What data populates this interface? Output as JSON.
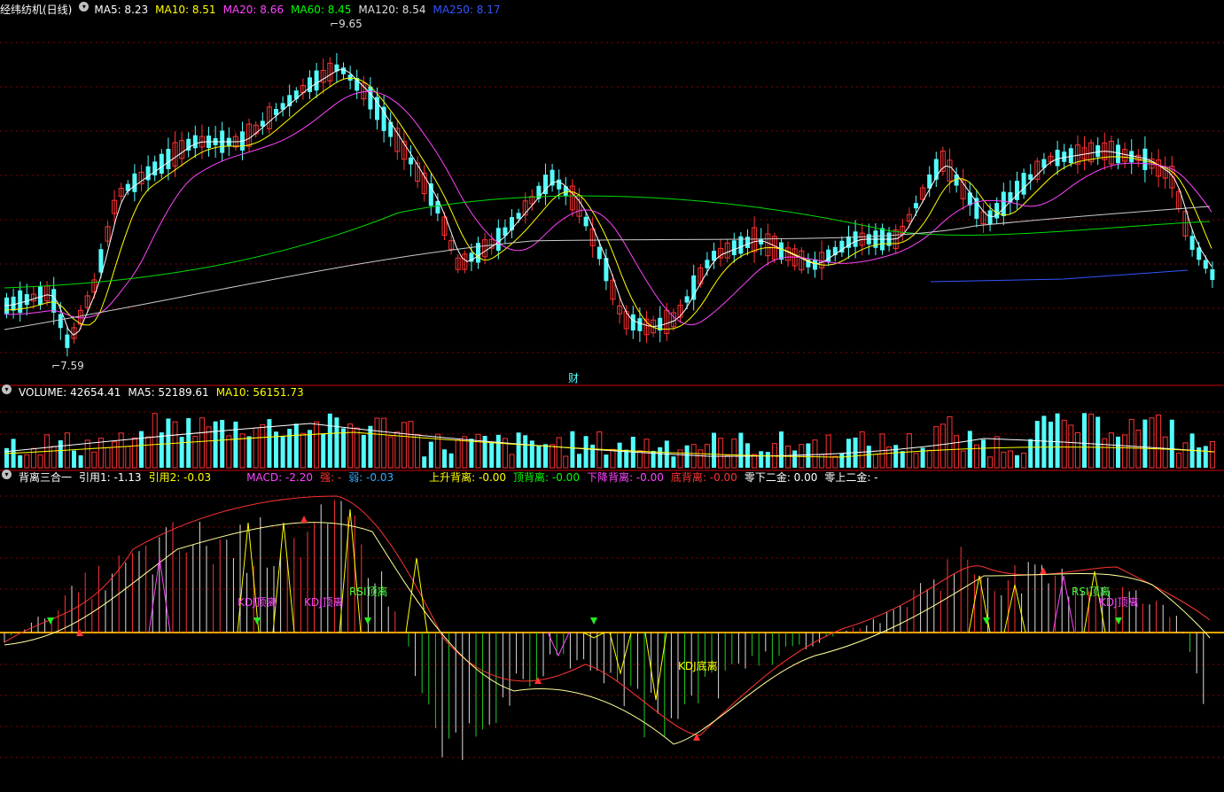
{
  "main": {
    "title": "经纬纺机(日线)",
    "ma": [
      {
        "label": "MA5: 8.23",
        "color": "#ffffff"
      },
      {
        "label": "MA10: 8.51",
        "color": "#ffff00"
      },
      {
        "label": "MA20: 8.66",
        "color": "#ff44ff"
      },
      {
        "label": "MA60: 8.45",
        "color": "#00ff00"
      },
      {
        "label": "MA120: 8.54",
        "color": "#dddddd"
      },
      {
        "label": "MA250: 8.17",
        "color": "#3355ff"
      }
    ],
    "high_label": "9.65",
    "low_label": "7.59",
    "event_marker": "财"
  },
  "volume": {
    "labels": [
      {
        "text": "VOLUME: 42654.41",
        "color": "#ffffff"
      },
      {
        "text": "MA5: 52189.61",
        "color": "#ffffff"
      },
      {
        "text": "MA10: 56151.73",
        "color": "#ffff00"
      }
    ]
  },
  "indicator": {
    "labels": [
      {
        "text": "背离三合一",
        "color": "#ffffff"
      },
      {
        "text": "引用1: -1.13",
        "color": "#ffffff"
      },
      {
        "text": "引用2: -0.03",
        "color": "#ffff00"
      },
      {
        "text": "MACD: -2.20",
        "color": "#ff44ff"
      },
      {
        "text": "强: -",
        "color": "#ff3333"
      },
      {
        "text": "弱: -0.03",
        "color": "#33aaff"
      },
      {
        "text": "上升背离: -0.00",
        "color": "#ffff00"
      },
      {
        "text": "顶背离: -0.00",
        "color": "#00ff00"
      },
      {
        "text": "下降背离: -0.00",
        "color": "#ff44ff"
      },
      {
        "text": "底背离: -0.00",
        "color": "#ff3333"
      },
      {
        "text": "零下二金: 0.00",
        "color": "#ffffff"
      },
      {
        "text": "零上二金: -",
        "color": "#ffffff"
      }
    ],
    "annotations": {
      "kdj_top_1": "KDJ顶离",
      "kdj_top_2": "KDJ顶离",
      "rsi_top_1": "RSI顶离",
      "kdj_bottom": "KDJ底离",
      "rsi_top_2": "RSI顶离",
      "kdj_top_3": "KDJ顶离"
    }
  },
  "colors": {
    "up": "#ff3232",
    "down": "#54fcfc",
    "grid": "#8b0000",
    "zero": "#ffa500"
  }
}
